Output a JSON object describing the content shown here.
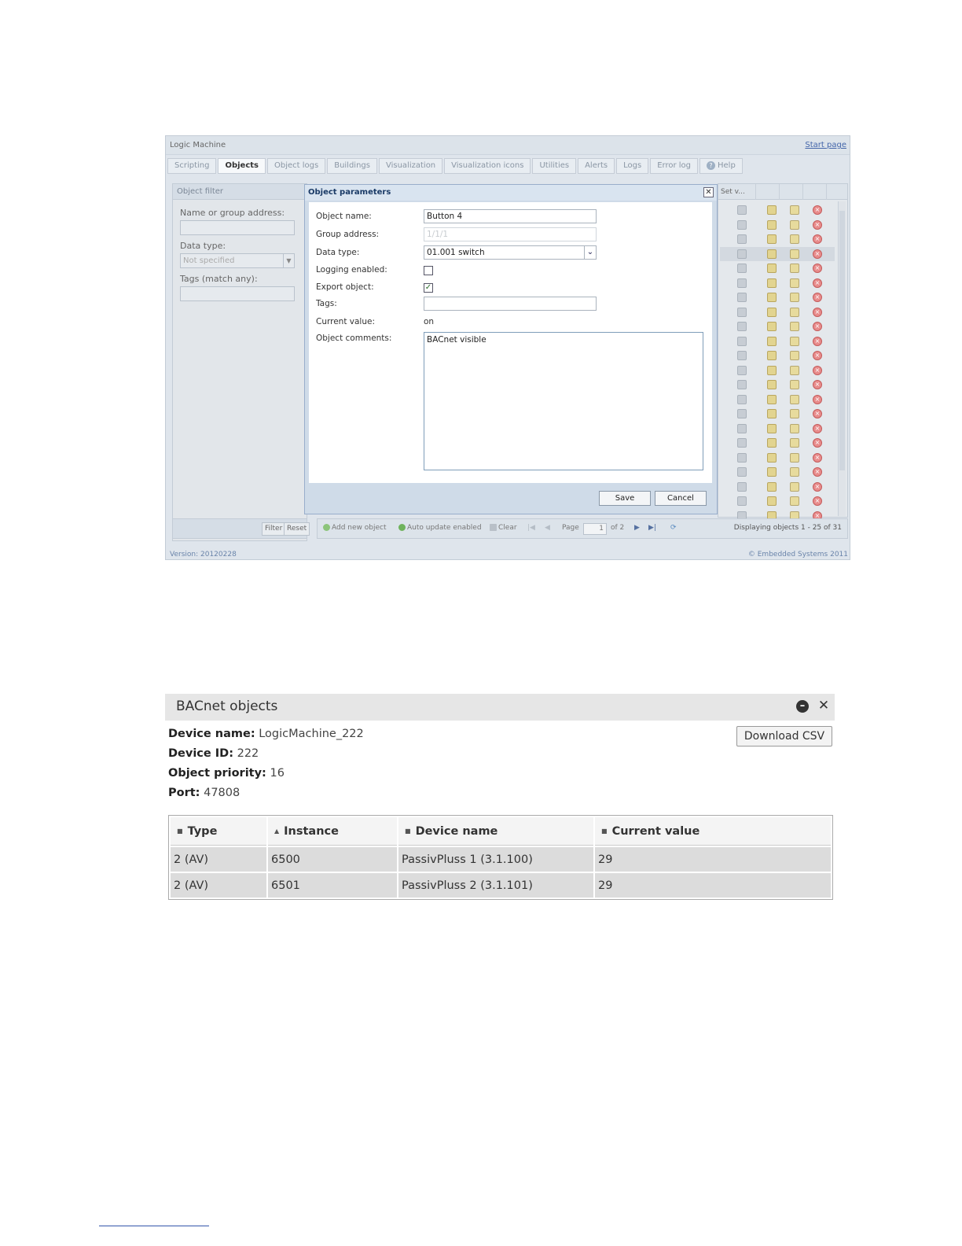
{
  "logic_machine": {
    "app_title": "Logic Machine",
    "start_page": "Start page",
    "tabs": [
      {
        "label": "Scripting"
      },
      {
        "label": "Objects"
      },
      {
        "label": "Object logs"
      },
      {
        "label": "Buildings"
      },
      {
        "label": "Visualization"
      },
      {
        "label": "Visualization icons"
      },
      {
        "label": "Utilities"
      },
      {
        "label": "Alerts"
      },
      {
        "label": "Logs"
      },
      {
        "label": "Error log"
      },
      {
        "label": "Help"
      }
    ],
    "active_tab": "Objects",
    "filter": {
      "title": "Object filter",
      "name_label": "Name or group address:",
      "data_type_label": "Data type:",
      "data_type_value": "Not specified",
      "tags_label": "Tags (match any):",
      "filter_button": "Filter",
      "reset_button": "Reset"
    },
    "grid": {
      "first_column_header": "Set v...",
      "visible_rows": 22
    },
    "toolbar": {
      "add_new_object": "Add new object",
      "auto_update": "Auto update enabled",
      "clear": "Clear",
      "page_label": "Page",
      "page_value": "1",
      "of_pages": "of 2",
      "displaying": "Displaying objects 1 - 25 of 31"
    },
    "footer": {
      "version": "Version: 20120228",
      "copyright": "© Embedded Systems 2011"
    },
    "modal": {
      "title": "Object parameters",
      "object_name_label": "Object name:",
      "object_name_value": "Button 4",
      "group_address_label": "Group address:",
      "group_address_value": "1/1/1",
      "data_type_label": "Data type:",
      "data_type_value": "01.001 switch",
      "logging_label": "Logging enabled:",
      "logging_checked": false,
      "export_label": "Export object:",
      "export_checked": true,
      "tags_label": "Tags:",
      "tags_value": "",
      "current_value_label": "Current value:",
      "current_value": "on",
      "comments_label": "Object comments:",
      "comments_value": "BACnet visible",
      "save_button": "Save",
      "cancel_button": "Cancel"
    }
  },
  "bacnet": {
    "title": "BACnet objects",
    "download_csv": "Download CSV",
    "device_name_label": "Device name:",
    "device_name": "LogicMachine_222",
    "device_id_label": "Device ID:",
    "device_id": "222",
    "priority_label": "Object priority:",
    "priority": "16",
    "port_label": "Port:",
    "port": "47808",
    "columns": [
      "Type",
      "Instance",
      "Device name",
      "Current value"
    ],
    "rows": [
      [
        "2 (AV)",
        "6500",
        "PassivPluss 1 (3.1.100)",
        "29"
      ],
      [
        "2 (AV)",
        "6501",
        "PassivPluss 2 (3.1.101)",
        "29"
      ]
    ]
  }
}
